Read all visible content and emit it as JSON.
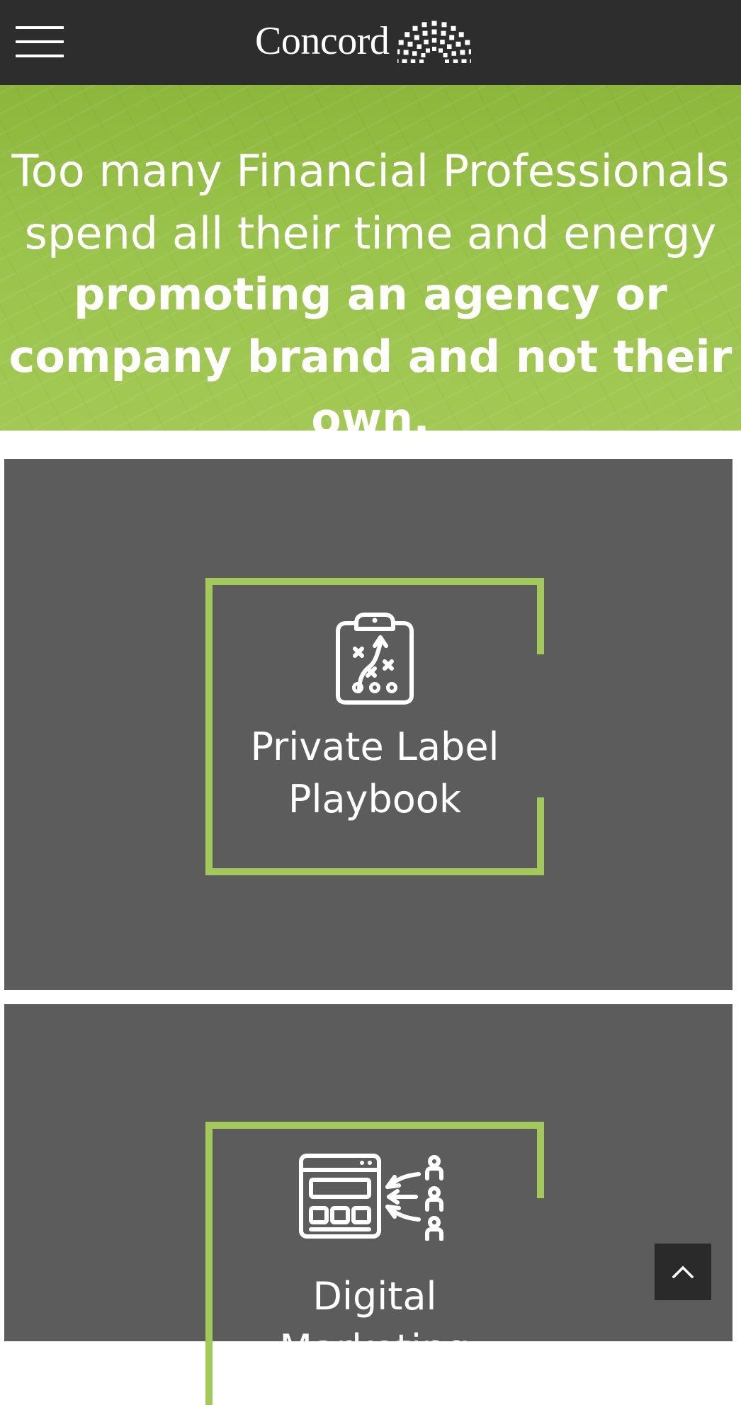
{
  "header": {
    "menu_icon": "hamburger-menu-icon",
    "logo_text": "Concord",
    "logo_icon": "sunburst-logo-icon",
    "background_color": "#2d2d2d"
  },
  "hero": {
    "text_light": "Too many Financial Professionals spend all their time and energy",
    "text_bold": "promoting an agency or company brand and not their own.",
    "background_color": "#96bf47"
  },
  "cards": [
    {
      "title": "Private Label Playbook",
      "icon": "clipboard-playbook-icon"
    },
    {
      "title": "Digital Marketing",
      "icon": "browser-audience-icon"
    }
  ],
  "back_to_top": {
    "icon": "chevron-up-icon"
  },
  "colors": {
    "accent": "#a3c95a",
    "card_background": "#5c5c5c"
  }
}
